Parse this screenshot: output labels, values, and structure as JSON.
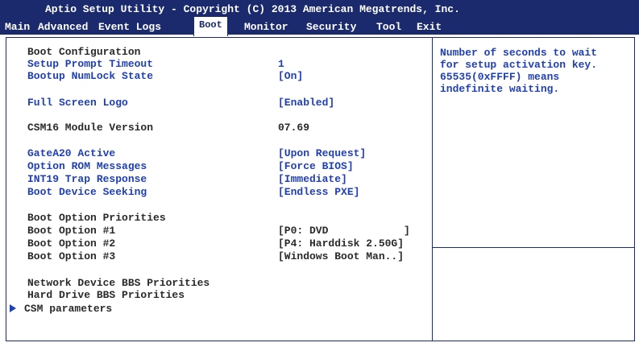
{
  "title": "Aptio Setup Utility - Copyright (C) 2013 American Megatrends, Inc.",
  "tabs": [
    "Main",
    "Advanced",
    "Event Logs",
    "Boot",
    "Monitor",
    "Security",
    "Tool",
    "Exit"
  ],
  "active_tab": "Boot",
  "rows": {
    "boot_config": "Boot Configuration",
    "setup_prompt_label": "Setup Prompt Timeout",
    "setup_prompt_value": "1",
    "numlock_label": "Bootup NumLock State",
    "numlock_value": "[On]",
    "logo_label": "Full Screen Logo",
    "logo_value": "[Enabled]",
    "csm_ver_label": "CSM16 Module Version",
    "csm_ver_value": "07.69",
    "gatea20_label": "GateA20 Active",
    "gatea20_value": "[Upon Request]",
    "optrom_label": "Option ROM Messages",
    "optrom_value": "[Force BIOS]",
    "int19_label": "INT19 Trap Response",
    "int19_value": "[Immediate]",
    "seek_label": "Boot Device Seeking",
    "seek_value": "[Endless PXE]",
    "priorities": "Boot Option Priorities",
    "opt1_label": "Boot Option #1",
    "opt1_value": "[P0: DVD            ]",
    "opt2_label": "Boot Option #2",
    "opt2_value": "[P4: Harddisk 2.50G]",
    "opt3_label": "Boot Option #3",
    "opt3_value": "[Windows Boot Man..]",
    "network_bbs": "Network Device BBS Priorities",
    "hdd_bbs": "Hard Drive BBS Priorities",
    "csm_params": "CSM parameters"
  },
  "help_text": "Number of seconds to wait\nfor setup activation key.\n65535(0xFFFF) means\nindefinite waiting.",
  "colors": {
    "header_bg": "#1a2a6c",
    "setting_text": "#1f3fb5",
    "static_text": "#2a2a2a"
  }
}
